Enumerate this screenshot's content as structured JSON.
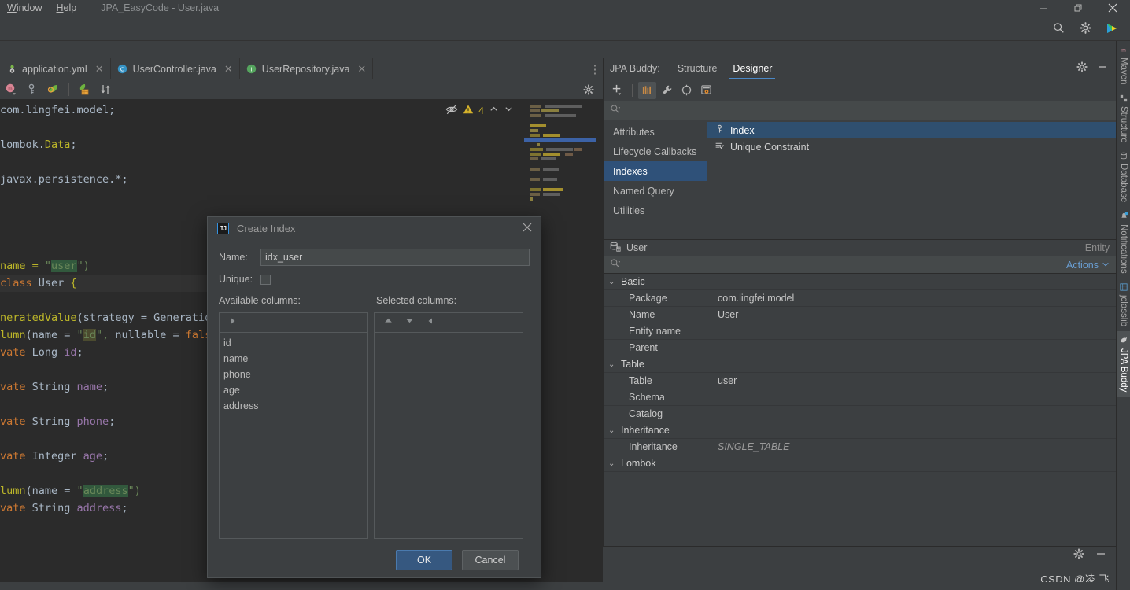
{
  "window": {
    "menus": [
      {
        "label": "Window",
        "mnemonic": "W"
      },
      {
        "label": "Help",
        "mnemonic": "H"
      }
    ],
    "title": "JPA_EasyCode - User.java",
    "controls": [
      {
        "name": "minimize-button",
        "glyph": "minimize-icon"
      },
      {
        "name": "maximize-button",
        "glyph": "restore-icon"
      },
      {
        "name": "close-button",
        "glyph": "close-icon"
      }
    ]
  },
  "navbar": {
    "icons": [
      {
        "name": "search-everywhere-icon",
        "label": "search-icon"
      },
      {
        "name": "settings-icon",
        "label": "gear-icon"
      },
      {
        "name": "run-icon",
        "label": "play-icon"
      }
    ]
  },
  "editor": {
    "tabs": [
      {
        "label": "application.yml",
        "icon": "yml-file-icon",
        "closable": true,
        "active": false
      },
      {
        "label": "UserController.java",
        "icon": "class-file-icon",
        "closable": true,
        "active": false
      },
      {
        "label": "UserRepository.java",
        "icon": "interface-file-icon",
        "closable": true,
        "active": false
      }
    ],
    "tab_overflow": "⋮",
    "toolbar_icons": [
      {
        "name": "maven-icon"
      },
      {
        "name": "key-icon"
      },
      {
        "name": "spring-leaf-icon"
      },
      {
        "name": "database-table-icon"
      },
      {
        "name": "sort-icon"
      }
    ],
    "inspection": {
      "eye_icon": "hide-inspections-icon",
      "warning_icon": "warning-triangle-icon",
      "warning_count": "4",
      "prev_icon": "chevron-up-icon",
      "next_icon": "chevron-down-icon"
    },
    "code_lines": [
      {
        "tokens": [
          {
            "t": "com.lingfei.model",
            "c": "typ"
          },
          {
            "t": ";",
            "c": "pun"
          }
        ]
      },
      {
        "tokens": []
      },
      {
        "tokens": [
          {
            "t": "lombok.",
            "c": "typ"
          },
          {
            "t": "Data",
            "c": "ann"
          },
          {
            "t": ";",
            "c": "pun"
          }
        ]
      },
      {
        "tokens": []
      },
      {
        "tokens": [
          {
            "t": "javax.persistence.*",
            "c": "typ"
          },
          {
            "t": ";",
            "c": "pun"
          }
        ]
      },
      {
        "tokens": []
      },
      {
        "tokens": []
      },
      {
        "tokens": []
      },
      {
        "tokens": []
      },
      {
        "tokens": [
          {
            "t": "name = ",
            "c": "ann"
          },
          {
            "t": "\"",
            "c": "str"
          },
          {
            "t": "user",
            "c": "str hl"
          },
          {
            "t": "\")",
            "c": "str"
          }
        ]
      },
      {
        "tokens": [
          {
            "t": "class ",
            "c": "kw"
          },
          {
            "t": "User ",
            "c": "typ"
          },
          {
            "t": "{",
            "c": "ann"
          }
        ],
        "caret": true
      },
      {
        "tokens": []
      },
      {
        "tokens": [
          {
            "t": "neratedValue",
            "c": "ann"
          },
          {
            "t": "(strategy = ",
            "c": "typ"
          },
          {
            "t": "Generatio",
            "c": "typ"
          }
        ]
      },
      {
        "tokens": [
          {
            "t": "lumn",
            "c": "ann"
          },
          {
            "t": "(name = ",
            "c": "typ"
          },
          {
            "t": "\"",
            "c": "str"
          },
          {
            "t": "id",
            "c": "str hl2"
          },
          {
            "t": "\", ",
            "c": "str"
          },
          {
            "t": "nullable = ",
            "c": "typ"
          },
          {
            "t": "fals",
            "c": "kw"
          }
        ]
      },
      {
        "tokens": [
          {
            "t": "vate ",
            "c": "kw"
          },
          {
            "t": "Long ",
            "c": "typ"
          },
          {
            "t": "id",
            "c": "fld"
          },
          {
            "t": ";",
            "c": "pun"
          }
        ]
      },
      {
        "tokens": []
      },
      {
        "tokens": [
          {
            "t": "vate ",
            "c": "kw"
          },
          {
            "t": "String ",
            "c": "typ"
          },
          {
            "t": "name",
            "c": "fld"
          },
          {
            "t": ";",
            "c": "pun"
          }
        ]
      },
      {
        "tokens": []
      },
      {
        "tokens": [
          {
            "t": "vate ",
            "c": "kw"
          },
          {
            "t": "String ",
            "c": "typ"
          },
          {
            "t": "phone",
            "c": "fld"
          },
          {
            "t": ";",
            "c": "pun"
          }
        ]
      },
      {
        "tokens": []
      },
      {
        "tokens": [
          {
            "t": "vate ",
            "c": "kw"
          },
          {
            "t": "Integer ",
            "c": "typ"
          },
          {
            "t": "age",
            "c": "fld"
          },
          {
            "t": ";",
            "c": "pun"
          }
        ]
      },
      {
        "tokens": []
      },
      {
        "tokens": [
          {
            "t": "lumn",
            "c": "ann"
          },
          {
            "t": "(name = ",
            "c": "typ"
          },
          {
            "t": "\"",
            "c": "str"
          },
          {
            "t": "address",
            "c": "str hl"
          },
          {
            "t": "\")",
            "c": "str"
          }
        ]
      },
      {
        "tokens": [
          {
            "t": "vate ",
            "c": "kw"
          },
          {
            "t": "String ",
            "c": "typ"
          },
          {
            "t": "address",
            "c": "fld"
          },
          {
            "t": ";",
            "c": "pun"
          }
        ]
      }
    ]
  },
  "jpa_buddy": {
    "panel_title": "JPA Buddy:",
    "tabs": [
      {
        "label": "Structure",
        "active": false
      },
      {
        "label": "Designer",
        "active": true
      }
    ],
    "header_icons": [
      {
        "name": "gear-icon"
      },
      {
        "name": "minimize-panel-icon"
      }
    ],
    "toolbar": [
      {
        "name": "add-icon",
        "selected": false
      },
      {
        "name": "columns-icon",
        "selected": true
      },
      {
        "name": "wrench-icon",
        "selected": false
      },
      {
        "name": "target-icon",
        "selected": false
      },
      {
        "name": "db-inspect-icon",
        "selected": false
      }
    ],
    "search_placeholder": "",
    "categories": [
      {
        "label": "Attributes",
        "active": false
      },
      {
        "label": "Lifecycle Callbacks",
        "active": false
      },
      {
        "label": "Indexes",
        "active": true
      },
      {
        "label": "Named Query",
        "active": false
      },
      {
        "label": "Utilities",
        "active": false
      }
    ],
    "items": [
      {
        "label": "Index",
        "icon": "index-key-icon",
        "selected": true
      },
      {
        "label": "Unique Constraint",
        "icon": "unique-constraint-icon",
        "selected": false
      }
    ]
  },
  "entity_panel": {
    "name": "User",
    "icon": "entity-table-icon",
    "kind": "Entity",
    "actions_label": "Actions",
    "search_placeholder": "",
    "groups": [
      {
        "label": "Basic",
        "expanded": true,
        "rows": [
          {
            "name": "Package",
            "value": "com.lingfei.model",
            "italic": false
          },
          {
            "name": "Name",
            "value": "User",
            "italic": false
          },
          {
            "name": "Entity name",
            "value": "",
            "italic": false
          },
          {
            "name": "Parent",
            "value": "",
            "italic": false
          }
        ]
      },
      {
        "label": "Table",
        "expanded": true,
        "rows": [
          {
            "name": "Table",
            "value": "user",
            "italic": false
          },
          {
            "name": "Schema",
            "value": "",
            "italic": false
          },
          {
            "name": "Catalog",
            "value": "",
            "italic": false
          }
        ]
      },
      {
        "label": "Inheritance",
        "expanded": true,
        "rows": [
          {
            "name": "Inheritance",
            "value": "SINGLE_TABLE",
            "italic": true
          }
        ]
      },
      {
        "label": "Lombok",
        "expanded": true,
        "rows": []
      }
    ]
  },
  "right_strip": {
    "tabs": [
      {
        "label": "Maven",
        "icon": "maven-m-icon",
        "active": false
      },
      {
        "label": "Structure",
        "icon": "structure-icon",
        "active": false
      },
      {
        "label": "Database",
        "icon": "database-icon",
        "active": false
      },
      {
        "label": "Notifications",
        "icon": "notifications-bell-icon",
        "active": false
      },
      {
        "label": "jclasslib",
        "icon": "jclasslib-icon",
        "active": false
      },
      {
        "label": "JPA Buddy",
        "icon": "jpa-buddy-icon",
        "active": true
      }
    ]
  },
  "bottom_bar": {
    "icons": [
      {
        "name": "gear-icon"
      },
      {
        "name": "hide-panel-icon"
      }
    ]
  },
  "watermark": "CSDN @凌 飞",
  "dialog": {
    "title": "Create Index",
    "logo": "intellij-idea-icon",
    "close_icon": "close-icon",
    "name_label": "Name:",
    "name_value": "idx_user",
    "unique_label": "Unique:",
    "unique_checked": false,
    "available_label": "Available columns:",
    "selected_label": "Selected columns:",
    "available_columns": [
      "id",
      "name",
      "phone",
      "age",
      "address"
    ],
    "selected_columns": [],
    "available_toolbar": [
      {
        "name": "move-right-icon"
      }
    ],
    "selected_toolbar": [
      {
        "name": "move-up-icon"
      },
      {
        "name": "move-down-icon"
      },
      {
        "name": "move-left-icon"
      }
    ],
    "ok_label": "OK",
    "cancel_label": "Cancel"
  },
  "colors": {
    "panel_bg": "#3c3f41",
    "editor_bg": "#2b2b2b",
    "selection_blue": "#2f5179",
    "accent_blue": "#4a88c7",
    "primary_button": "#365880",
    "link_blue": "#6a9fd4",
    "warning_yellow": "#c9b227"
  }
}
